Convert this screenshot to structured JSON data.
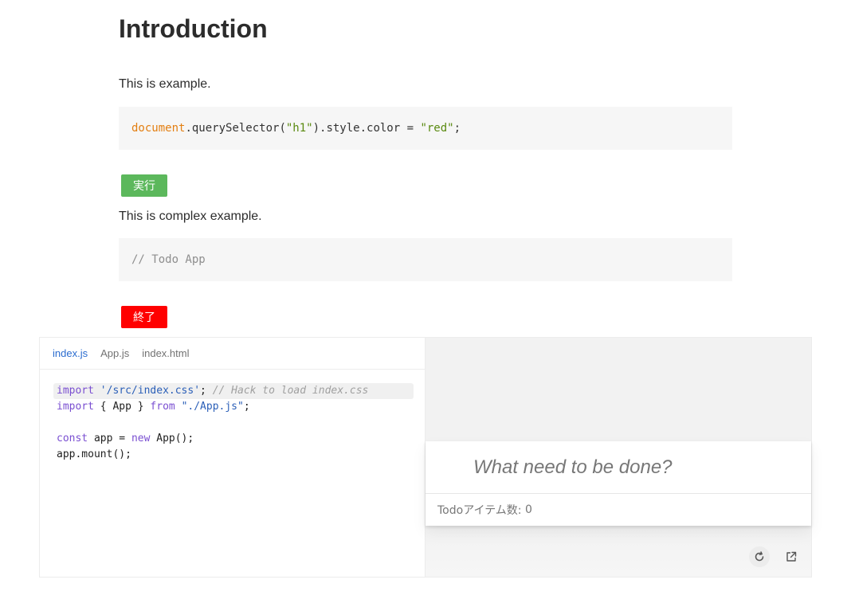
{
  "doc": {
    "title": "Introduction",
    "paragraph_1": "This is example.",
    "code_1": {
      "global": "document",
      "mid": ".querySelector(",
      "arg": "\"h1\"",
      "after": ").style.color = ",
      "value": "\"red\"",
      "end": ";"
    },
    "run_button": "実行",
    "paragraph_2": "This is complex example.",
    "code_2": "// Todo App",
    "end_button": "終了"
  },
  "sandbox": {
    "tabs": [
      {
        "label": "index.js",
        "active": true
      },
      {
        "label": "App.js",
        "active": false
      },
      {
        "label": "index.html",
        "active": false
      }
    ],
    "code": {
      "line_1": {
        "kw": "import",
        "str": "'/src/index.css'",
        "semi": ";",
        "comment": "// Hack to load index.css"
      },
      "line_2": {
        "kw": "import",
        "mid": "{ App }",
        "kw2": "from",
        "str": "\"./App.js\"",
        "semi": ";"
      },
      "line_4": {
        "kw": "const",
        "mid": "app =",
        "kw2": "new",
        "rest": "App();"
      },
      "line_5": "app.mount();"
    },
    "preview": {
      "input_placeholder": "What need to be done?",
      "count_label": "Todoアイテム数:",
      "count_value": "0",
      "refresh_icon": "refresh-icon",
      "open_icon": "external-link-icon"
    }
  },
  "colors": {
    "run_button": "#5cb85c",
    "end_button": "#ff0000",
    "active_tab": "#2b6ccf",
    "keyword": "#7a4fd1",
    "string": "#2b5fb8"
  }
}
